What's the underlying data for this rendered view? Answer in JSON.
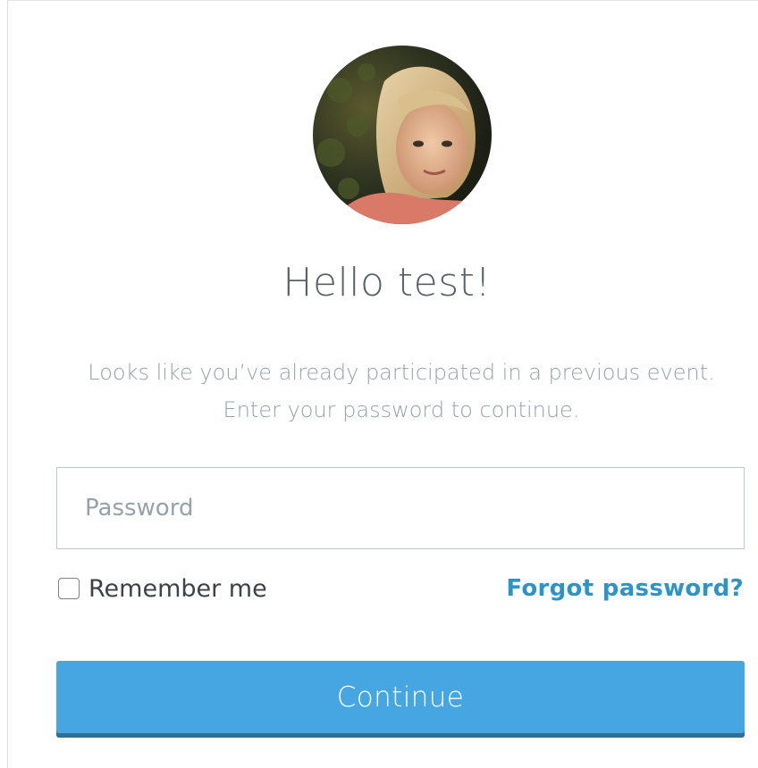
{
  "greeting": "Hello test!",
  "message": "Looks like you’ve already participated in a previous event. Enter your password to continue.",
  "password": {
    "placeholder": "Password",
    "value": ""
  },
  "remember_me": {
    "label": "Remember me",
    "checked": false
  },
  "forgot_password_label": "Forgot password?",
  "continue_label": "Continue",
  "colors": {
    "accent": "#46a6e2",
    "link": "#2d94c7",
    "heading_text": "#5a6068",
    "muted_text": "#96a1a8"
  }
}
